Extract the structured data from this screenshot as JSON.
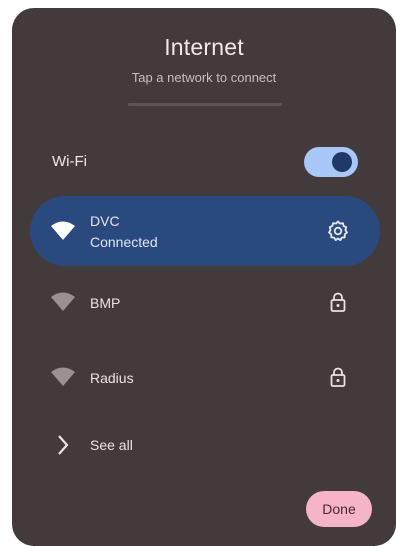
{
  "dialog": {
    "title": "Internet",
    "subtitle": "Tap a network to connect"
  },
  "wifi": {
    "label": "Wi-Fi",
    "enabled": true
  },
  "networks": [
    {
      "name": "DVC",
      "status": "Connected",
      "icon": "wifi-icon",
      "action_icon": "gear-icon"
    },
    {
      "name": "BMP",
      "status": "",
      "icon": "wifi-icon",
      "action_icon": "lock-icon"
    },
    {
      "name": "Radius",
      "status": "",
      "icon": "wifi-icon",
      "action_icon": "lock-icon"
    }
  ],
  "see_all": {
    "label": "See all",
    "icon": "chevron-right-icon"
  },
  "done_label": "Done",
  "colors": {
    "dialog_background": "#433b3b",
    "connected_highlight": "#2a4a7f",
    "toggle_track": "#a9c7f9",
    "done_button": "#f5b5c6"
  }
}
